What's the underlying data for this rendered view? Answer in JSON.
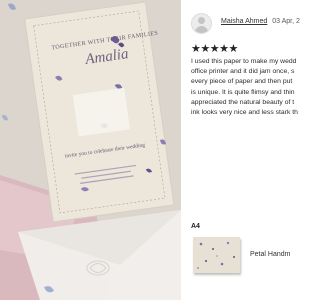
{
  "photo": {
    "invitation": {
      "heading": "TOGETHER WITH THEIR FAMILIES",
      "name": "Amalia",
      "details": "invite you to celebrate their wedding"
    }
  },
  "review": {
    "reviewer_name": "Maisha Ahmed",
    "date": "03 Apr, 2",
    "stars": "★★★★★",
    "rating": 5,
    "body_lines": [
      "I used this paper to make my wedd",
      "office printer and it did jam once, s",
      "every piece of paper and then put",
      "is unique. It is quite flimsy and thin",
      "appreciated the natural beauty of t",
      "ink looks very nice and less stark th"
    ],
    "variant_label": "A4",
    "product_name": "Petal Handm"
  }
}
